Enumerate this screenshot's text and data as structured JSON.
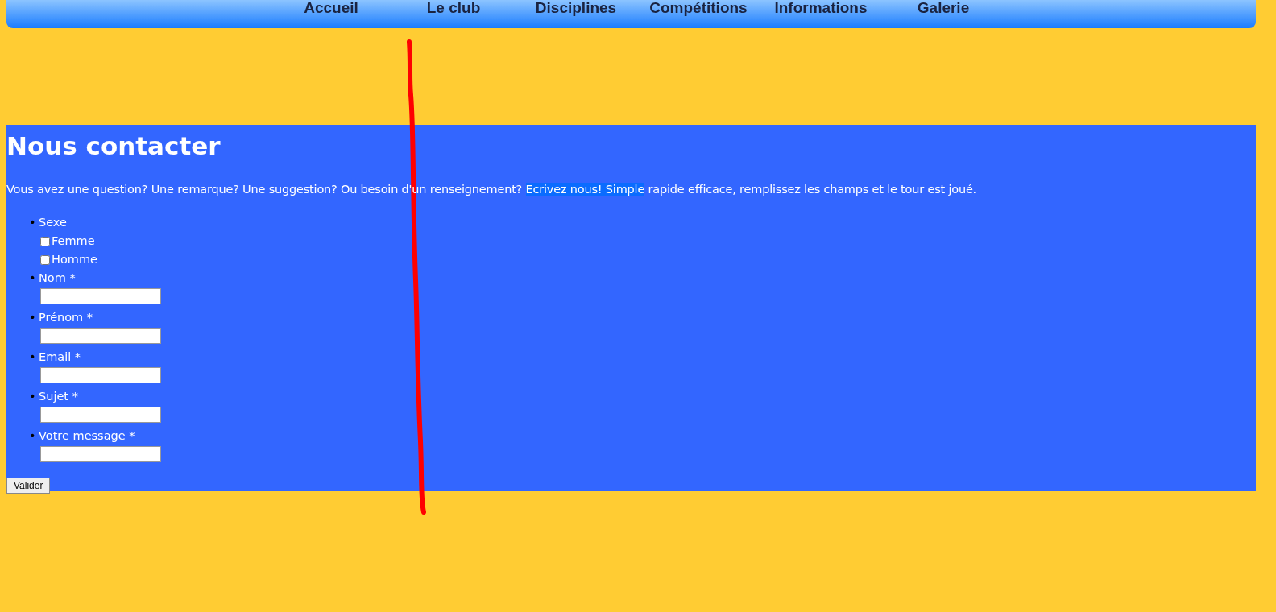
{
  "nav": {
    "items": [
      {
        "label": "Accueil"
      },
      {
        "label": "Le club"
      },
      {
        "label": "Disciplines"
      },
      {
        "label": "Compétitions"
      },
      {
        "label": "Informations"
      },
      {
        "label": "Galerie"
      }
    ]
  },
  "contact": {
    "title": "Nous contacter",
    "intro": {
      "before": "Vous avez une question? Une remarque? Une suggestion? Ou besoin d'un renseignement? ",
      "selected_text": "Ecrivez nous! Simple",
      "after": " rapide efficace, remplissez les champs et le tour est joué."
    },
    "fields": [
      {
        "kind": "checkboxes",
        "marker": "•",
        "label": "Sexe",
        "options": [
          {
            "label": "Femme",
            "checked": false
          },
          {
            "label": "Homme",
            "checked": false
          }
        ]
      },
      {
        "kind": "text",
        "marker": "•",
        "label": "Nom *"
      },
      {
        "kind": "text",
        "marker": "•",
        "label": "Prénom *"
      },
      {
        "kind": "text",
        "marker": "•",
        "label": "Email *"
      },
      {
        "kind": "text",
        "marker": "•",
        "label": "Sujet *"
      },
      {
        "kind": "text",
        "marker": "•",
        "label": "Votre message *"
      }
    ],
    "submit": "Valider"
  }
}
